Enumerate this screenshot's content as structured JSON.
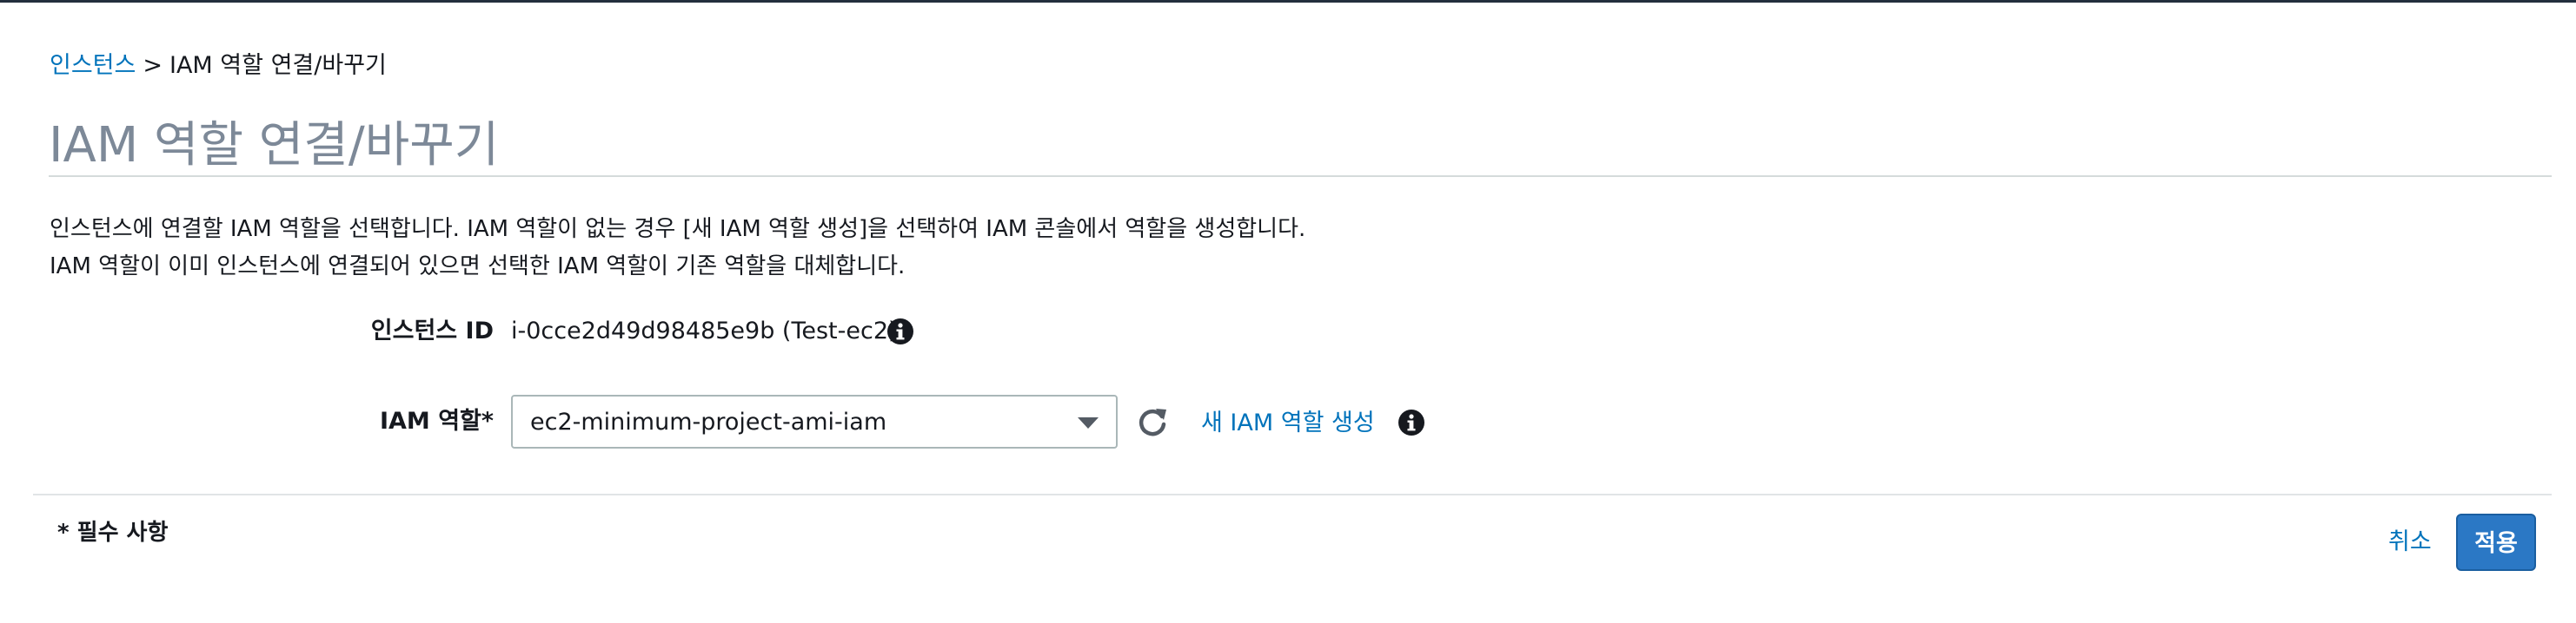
{
  "breadcrumb": {
    "root_label": "인스턴스",
    "separator": ">",
    "current_label": "IAM 역할 연결/바꾸기"
  },
  "page": {
    "title": "IAM 역할 연결/바꾸기",
    "description_line1": "인스턴스에 연결할 IAM 역할을 선택합니다. IAM 역할이 없는 경우 [새 IAM 역할 생성]을 선택하여 IAM 콘솔에서 역할을 생성합니다.",
    "description_line2": "IAM 역할이 이미 인스턴스에 연결되어 있으면 선택한 IAM 역할이 기존 역할을 대체합니다."
  },
  "form": {
    "instance_id_label": "인스턴스 ID",
    "instance_id_value": "i-0cce2d49d98485e9b (Test-ec2)",
    "iam_role_label": "IAM 역할*",
    "iam_role_selected": "ec2-minimum-project-ami-iam",
    "create_role_link": "새 IAM 역할 생성"
  },
  "footer": {
    "required_note": "* 필수 사항",
    "cancel_label": "취소",
    "apply_label": "적용"
  },
  "icons": {
    "info": "info-icon",
    "refresh": "refresh-icon",
    "dropdown": "chevron-down-icon"
  },
  "colors": {
    "link": "#0073bb",
    "primary_button": "#2b78c5",
    "title": "#7d8998",
    "text": "#16191f"
  }
}
